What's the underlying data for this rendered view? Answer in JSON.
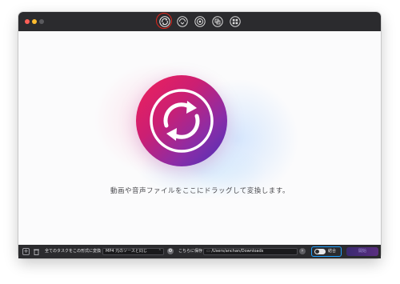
{
  "toolbar": {
    "tools": [
      {
        "name": "convert",
        "active": true
      },
      {
        "name": "compress",
        "active": false
      },
      {
        "name": "record",
        "active": false
      },
      {
        "name": "merge",
        "active": false
      },
      {
        "name": "toolbox",
        "active": false
      }
    ]
  },
  "main": {
    "hint": "動画や音声ファイルをここにドラッグして変換します。"
  },
  "bottombar": {
    "convert_all_label": "全てのタスクをこの形式に変換",
    "format_value": "MP4 元のソースと同じ",
    "save_to_label": "こちらに保存",
    "save_path": "/Users/anchan/Downloads",
    "merge_label": "結合",
    "start_label": "開始"
  },
  "colors": {
    "accent_red": "#e0261b",
    "accent_blue": "#1ea1ff",
    "titlebar": "#2b2b2e"
  }
}
